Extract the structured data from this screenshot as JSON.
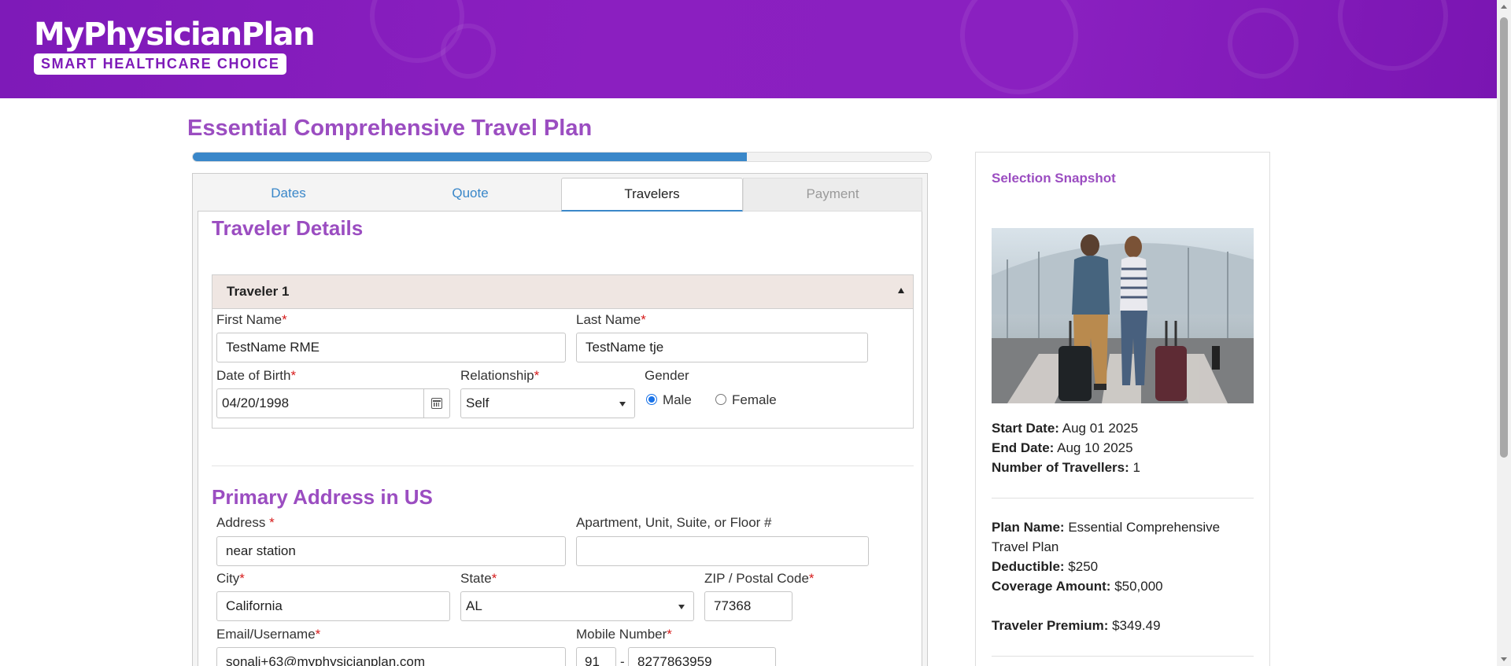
{
  "header": {
    "logo_title": "MyPhysicianPlan",
    "logo_tagline": "SMART HEALTHCARE CHOICE",
    "brand_color": "#8b1fc0"
  },
  "page": {
    "title": "Essential Comprehensive Travel Plan",
    "progress_percent": 75
  },
  "tabs": [
    {
      "label": "Dates",
      "state": "link"
    },
    {
      "label": "Quote",
      "state": "link"
    },
    {
      "label": "Travelers",
      "state": "active"
    },
    {
      "label": "Payment",
      "state": "disabled"
    }
  ],
  "traveler_section": {
    "title": "Traveler Details",
    "accordion_title": "Traveler 1",
    "first_name_label": "First Name",
    "first_name_value": "TestName RME",
    "last_name_label": "Last Name",
    "last_name_value": "TestName tje",
    "dob_label": "Date of Birth",
    "dob_value": "04/20/1998",
    "relationship_label": "Relationship",
    "relationship_value": "Self",
    "gender_label": "Gender",
    "gender_male": "Male",
    "gender_female": "Female",
    "gender_selected": "Male"
  },
  "address_section": {
    "title": "Primary Address in US",
    "address_label": "Address ",
    "address_value": "near station",
    "apt_label": "Apartment, Unit, Suite, or Floor #",
    "apt_value": "",
    "city_label": "City",
    "city_value": "California",
    "state_label": "State",
    "state_value": "AL",
    "zip_label": "ZIP / Postal Code",
    "zip_value": "77368",
    "email_label": "Email/Username",
    "email_value": "sonali+63@myphysicianplan.com",
    "mobile_label": "Mobile Number",
    "mobile_code": "91",
    "mobile_separator": "-",
    "mobile_value": "8277863959",
    "required_marker": "*"
  },
  "snapshot": {
    "title": "Selection Snapshot",
    "start_date_label": "Start Date:",
    "start_date_value": "Aug 01 2025",
    "end_date_label": "End Date:",
    "end_date_value": "Aug 10 2025",
    "travellers_label": "Number of Travellers:",
    "travellers_value": "1",
    "plan_name_label": "Plan Name:",
    "plan_name_value": "Essential Comprehensive Travel Plan",
    "deductible_label": "Deductible:",
    "deductible_value": "$250",
    "coverage_label": "Coverage Amount:",
    "coverage_value": "$50,000",
    "premium_label": "Traveler Premium:",
    "premium_value": "$349.49"
  }
}
